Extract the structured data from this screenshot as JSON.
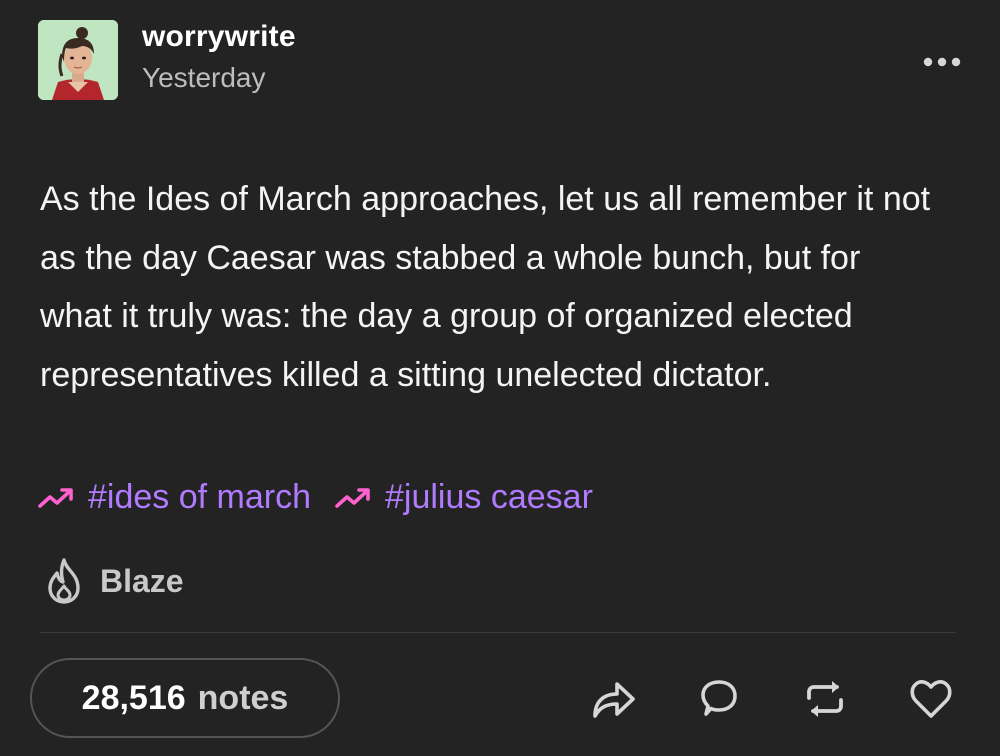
{
  "post": {
    "blog_name": "worrywrite",
    "timestamp": "Yesterday",
    "body": "As the Ides of March approaches, let us all remember it not as the day Caesar was stabbed a whole bunch, but for what it truly was: the day a group of organized elected representatives killed a sitting unelected dictator.",
    "tags": [
      {
        "label": "#ides of march",
        "icon": "trending-icon"
      },
      {
        "label": "#julius caesar",
        "icon": "trending-icon"
      }
    ],
    "blaze_label": "Blaze",
    "notes_count": "28,516",
    "notes_label": "notes"
  },
  "actions": [
    {
      "name": "share",
      "icon": "share-icon"
    },
    {
      "name": "reply",
      "icon": "reply-icon"
    },
    {
      "name": "reblog",
      "icon": "reblog-icon"
    },
    {
      "name": "like",
      "icon": "heart-icon"
    }
  ],
  "colors": {
    "background": "#232323",
    "tag_text": "#b17bff",
    "tag_icon": "#ff62ce",
    "muted_text": "#bdbdbd"
  }
}
